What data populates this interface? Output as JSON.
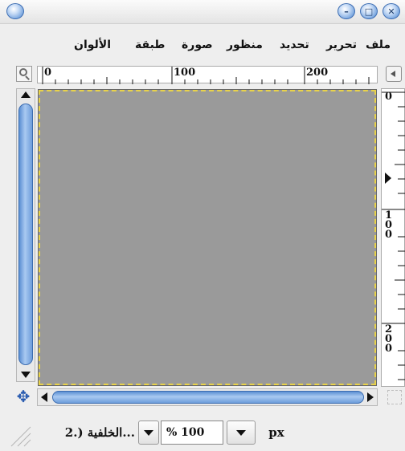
{
  "window": {
    "buttons": {
      "menu_icon": "menu-orb-icon",
      "minimize_icon": "minimize-icon",
      "maximize_icon": "maximize-icon",
      "close_icon": "close-icon",
      "minimize_glyph": "–",
      "maximize_glyph": "□",
      "close_glyph": "✕"
    }
  },
  "menubar": {
    "items": [
      {
        "label": "ملف"
      },
      {
        "label": "تحرير"
      },
      {
        "label": "تحديد"
      },
      {
        "label": "منظور"
      },
      {
        "label": "صورة"
      },
      {
        "label": "طبقة"
      },
      {
        "label": "الألوان"
      }
    ]
  },
  "rulers": {
    "horizontal": [
      "0",
      "100",
      "200"
    ],
    "vertical": [
      "0",
      "1",
      "0",
      "0",
      "2",
      "0",
      "0"
    ]
  },
  "statusbar": {
    "layer": "...الخلفية (.2",
    "zoom": "% 100",
    "unit": "px"
  },
  "colors": {
    "canvas": "#9a9a9a",
    "selection_border": "#e8d24a",
    "scroll_thumb": "#6d9ddb"
  }
}
